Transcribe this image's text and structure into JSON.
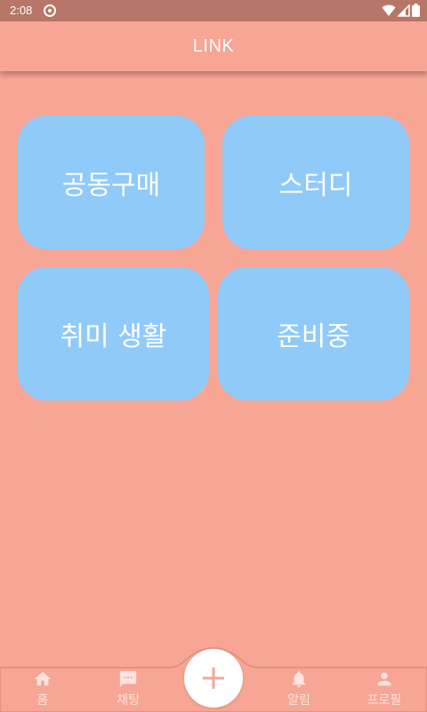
{
  "status_bar": {
    "time": "2:08",
    "icons": [
      "sync-icon",
      "wifi-icon",
      "signal-icon",
      "battery-icon"
    ]
  },
  "app_bar": {
    "title": "LINK"
  },
  "categories": [
    {
      "label": "공동구매"
    },
    {
      "label": "스터디"
    },
    {
      "label": "취미 생활"
    },
    {
      "label": "준비중"
    }
  ],
  "bottom_nav": {
    "items": [
      {
        "label": "홈",
        "icon": "home-icon"
      },
      {
        "label": "채팅",
        "icon": "chat-icon"
      },
      {
        "label": "알림",
        "icon": "bell-icon"
      },
      {
        "label": "프로필",
        "icon": "person-icon"
      }
    ],
    "fab_icon": "plus-icon"
  },
  "colors": {
    "background": "#F7A595",
    "status_bar": "#B77668",
    "card": "#90CAF9",
    "nav_icon": "#FFE3DE",
    "fab_icon": "#F7A595",
    "text_light": "#FFFFFF"
  }
}
